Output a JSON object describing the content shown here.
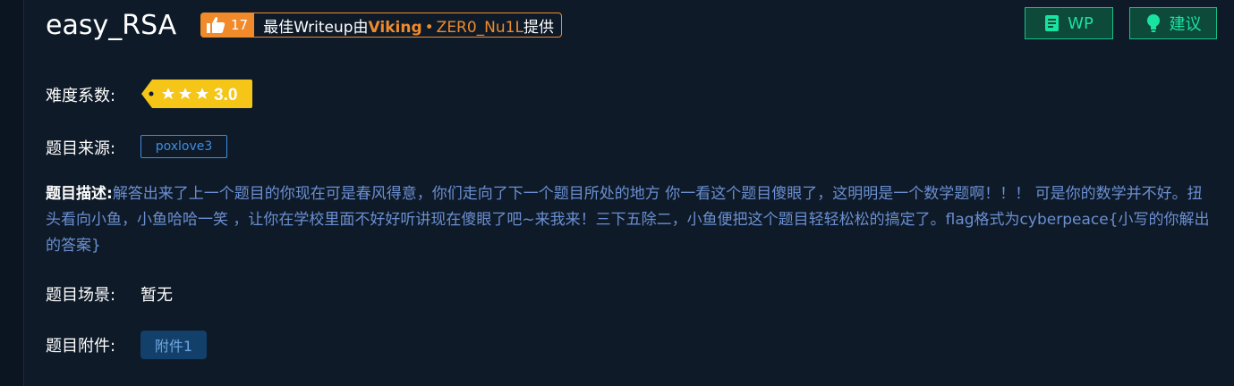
{
  "challenge": {
    "title": "easy_RSA",
    "likes": "17",
    "writeup_prefix": "最佳Writeup由",
    "writeup_author": "Viking",
    "writeup_separator": "•",
    "writeup_team": "ZER0_Nu1L",
    "writeup_suffix": "提供"
  },
  "buttons": {
    "wp_label": "WP",
    "suggest_label": "建议"
  },
  "difficulty": {
    "label": "难度系数:",
    "value": "3.0",
    "stars": 3
  },
  "source": {
    "label": "题目来源:",
    "value": "poxlove3"
  },
  "description": {
    "label": "题目描述:",
    "text": "解答出来了上一个题目的你现在可是春风得意，你们走向了下一个题目所处的地方 你一看这个题目傻眼了，这明明是一个数学题啊！！！ 可是你的数学并不好。扭头看向小鱼，小鱼哈哈一笑 ，让你在学校里面不好好听讲现在傻眼了吧~来我来！三下五除二，小鱼便把这个题目轻轻松松的搞定了。flag格式为cyberpeace{小写的你解出的答案}"
  },
  "scene": {
    "label": "题目场景:",
    "value": "暂无"
  },
  "attachment": {
    "label": "题目附件:",
    "button": "附件1"
  },
  "colors": {
    "accent_orange": "#f08a2a",
    "accent_green": "#19e3a0",
    "link_blue": "#3e8de0",
    "desc_blue": "#6b8fd1",
    "tag_yellow": "#f5c518"
  }
}
